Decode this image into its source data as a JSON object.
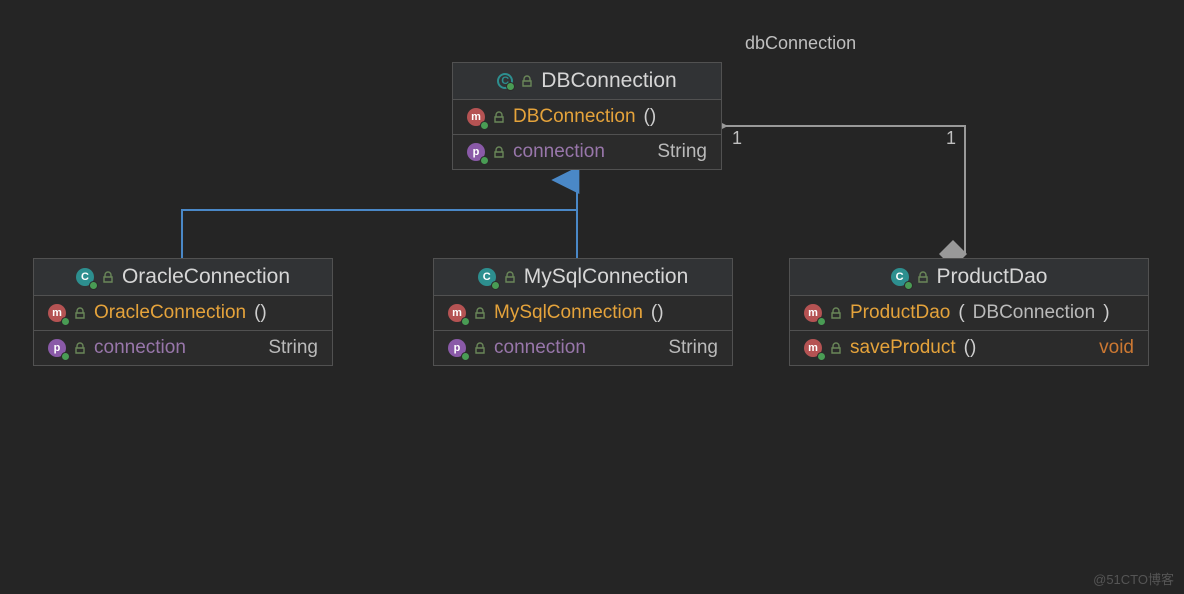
{
  "diagram": {
    "association_label": "dbConnection",
    "multiplicity_a": "1",
    "multiplicity_b": "1",
    "watermark": "@51CTO博客"
  },
  "classes": {
    "db": {
      "name": "DBConnection",
      "ctor": "DBConnection",
      "prop": "connection",
      "prop_type": "String"
    },
    "oracle": {
      "name": "OracleConnection",
      "ctor": "OracleConnection",
      "prop": "connection",
      "prop_type": "String"
    },
    "mysql": {
      "name": "MySqlConnection",
      "ctor": "MySqlConnection",
      "prop": "connection",
      "prop_type": "String"
    },
    "dao": {
      "name": "ProductDao",
      "ctor": "ProductDao",
      "ctor_param": "DBConnection",
      "method": "saveProduct",
      "method_ret": "void"
    }
  }
}
